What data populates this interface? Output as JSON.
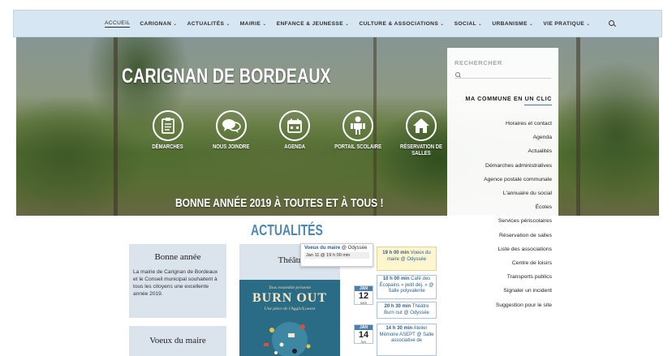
{
  "nav": {
    "items": [
      {
        "label": "ACCUEIL",
        "chevron": false,
        "active": true
      },
      {
        "label": "CARIGNAN",
        "chevron": true
      },
      {
        "label": "ACTUALITÉS",
        "chevron": true
      },
      {
        "label": "MAIRIE",
        "chevron": true
      },
      {
        "label": "ENFANCE & JEUNESSE",
        "chevron": true
      },
      {
        "label": "CULTURE & ASSOCIATIONS",
        "chevron": true
      },
      {
        "label": "SOCIAL",
        "chevron": true
      },
      {
        "label": "URBANISME",
        "chevron": true
      },
      {
        "label": "VIE PRATIQUE",
        "chevron": true
      }
    ],
    "chevron_glyph": "⌄",
    "search_icon": "search-icon"
  },
  "hero": {
    "title": "CARIGNAN DE BORDEAUX",
    "banner": "BONNE ANNÉE 2019 À TOUTES ET À TOUS !",
    "quick_links": [
      {
        "label": "DÉMARCHES",
        "icon": "clipboard-icon"
      },
      {
        "label": "NOUS JOINDRE",
        "icon": "chat-bubbles-icon"
      },
      {
        "label": "AGENDA",
        "icon": "calendar-icon"
      },
      {
        "label": "PORTAIL SCOLAIRE",
        "icon": "person-icon"
      },
      {
        "label": "RÉSERVATION DE SALLES",
        "icon": "house-icon"
      }
    ]
  },
  "sidebar": {
    "search_placeholder": "RECHERCHER",
    "title": "MA COMMUNE EN UN CLIC",
    "links": [
      "Horaires et contact",
      "Agenda",
      "Actualités",
      "Démarches administratives",
      "Agence postale communale",
      "L'annuaire du social",
      "Écoles",
      "Services périscolaires",
      "Réservation de salles",
      "Liste des associations",
      "Centre de loisirs",
      "Transports publics",
      "Signaler un incident",
      "Suggestion pour le site"
    ]
  },
  "news": {
    "title": "ACTUALITÉS",
    "cards": [
      {
        "title": "Bonne année",
        "text": "La mairie de Carignan de Bordeaux et le Conseil municipal souhaitent à tous les citoyens une excellente année 2019."
      },
      {
        "title": "Voeux du maire",
        "text": ""
      }
    ],
    "feature_title": "Théâtr",
    "poster": {
      "line1": "Tous ensemble présente",
      "line2": "BURN OUT",
      "line3": "Une pièce de l'Agglo'Lowest"
    }
  },
  "calendar": {
    "tooltip": {
      "title": "Voeux du maire",
      "place": "@ Odyssée",
      "date": "Jan 11 @ 19 h 00 min"
    },
    "days": [
      {
        "month": "JAN",
        "num": "12",
        "dow": "sam"
      },
      {
        "month": "JAN",
        "num": "14",
        "dow": "lun"
      }
    ],
    "events": [
      {
        "time": "19 h 00 min",
        "text": "Voeux du maire @ Odyssée",
        "highlight": true
      },
      {
        "time": "10 h 00 min",
        "text": "Café des Écopains « petit déj. » @ Salle polyvalente",
        "highlight": false
      },
      {
        "time": "20 h 30 min",
        "text": "Théâtre Burn out @ Odyssée",
        "highlight": false
      },
      {
        "time": "14 h 30 min",
        "text": "Atelier Mémoire ASEPT @ Salle associative de",
        "highlight": false
      }
    ]
  },
  "colors": {
    "nav_bg": "#d6e6f2",
    "accent_blue": "#4c88b3",
    "card_bg": "#dbe3ec",
    "poster_bg": "#2a6b86",
    "event_highlight": "#fff6cf"
  }
}
